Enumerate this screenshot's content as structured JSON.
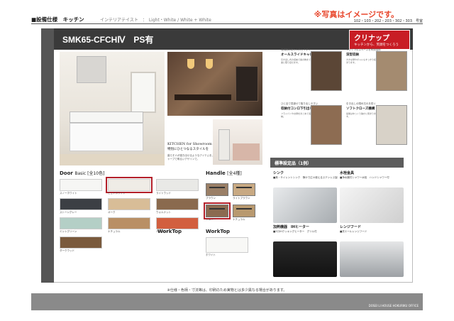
{
  "header": {
    "spec_label": "■設備仕様　キッチン",
    "subtitle": "インテリアテイスト　：　Light・White / White + White",
    "notice": "※写真はイメージです。",
    "rooms": "102・103・202・203・302・303　号室"
  },
  "title": {
    "model": "SMK65-CFCHⅣ　PS有",
    "logo_name": "クリナップ",
    "logo_tagline": "キッチンから、笑顔をつくろう"
  },
  "kitchen_caption": {
    "line1": "KITCHEN for Showroom",
    "line2": "特別にひとつなるスタイルを",
    "line3": "暮らす人が描き出せるようなアイテムを、シャープで明るいデザインで。"
  },
  "features": [
    {
      "small": "収納物の出し入れしやすく",
      "title": "オールスライドキャビネット",
      "desc": "引き出し式の収納で奥の物まで楽に取り出せます。"
    },
    {
      "small": "シンク下のスペースを有効活用",
      "title": "深型収納",
      "desc": "大きな鍋やボトルもすっきり収まります。"
    },
    {
      "small": "ひと目で見渡せて取り出しやすい",
      "title": "収納付コンロ下引出し",
      "desc": "フライパンやお鍋をまとめて収納。"
    },
    {
      "small": "引き出しの閉め忘れを防ぐ",
      "title": "ソフトクローズ機構",
      "desc": "最後はゆっくり静かに閉まります。"
    }
  ],
  "standard": {
    "header": "標準設定品（1例）",
    "items": [
      {
        "name": "シンク",
        "desc": "■美・サイレントシンク　静かで広々使えるステンレス製"
      },
      {
        "name": "水栓金具",
        "desc": "■浄水器付シャワー水栓　ハンドシャワー付"
      },
      {
        "name": "加熱機器　IHヒーター",
        "desc": "■3口IHクッキングヒーター　グリル付"
      },
      {
        "name": "レンジフード",
        "desc": "■洗エールレンジフード"
      }
    ]
  },
  "door": {
    "title": "Door",
    "subtitle": "Basic [全10色]",
    "swatches": [
      {
        "label": "スノーホワイト",
        "color": "#f6f6f4"
      },
      {
        "label": "ピュアホワイト",
        "color": "#efece6"
      },
      {
        "label": "ライトウッド",
        "color": "#e9e9e6"
      },
      {
        "label": "ストーングレー",
        "color": "#3c3f44"
      },
      {
        "label": "オーク",
        "color": "#d8bd97"
      },
      {
        "label": "ウォルナット",
        "color": "#8a6a4e"
      },
      {
        "label": "ミントグリーン",
        "color": "#b4cfc6"
      },
      {
        "label": "ナチュラル",
        "color": "#b98f65"
      },
      {
        "label": "テラコッタ",
        "color": "#d25f3f"
      },
      {
        "label": "ダークウッド",
        "color": "#7a5a3d"
      }
    ]
  },
  "handle": {
    "title": "Handle",
    "subtitle": "[全4種]",
    "items": [
      {
        "label": "ブラウン"
      },
      {
        "label": "ライトブラウン"
      },
      {
        "label": "シルバー"
      },
      {
        "label": "ナチュラル"
      }
    ]
  },
  "worktop": {
    "title_left": "WorkTop",
    "title_right": "WorkTop",
    "label": "ホワイト"
  },
  "footer": {
    "note": "※仕様・色柄・寸法等は、印刷のため実物とは多少異なる場合があります。",
    "company": "DOSEI LI HOUSE  HOKURIKU OFFICE"
  }
}
